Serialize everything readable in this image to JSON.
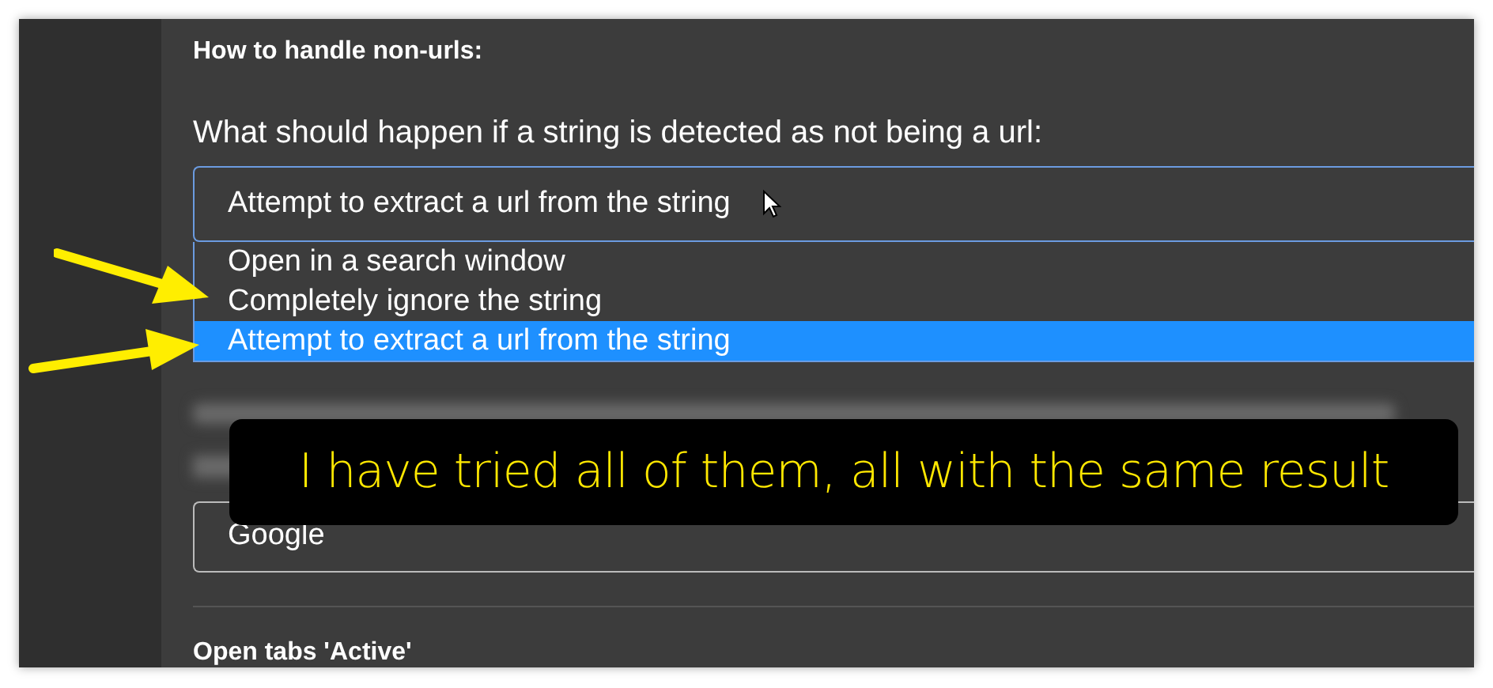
{
  "section_title": "How to handle non-urls:",
  "question": "What should happen if a string is detected as not being a url:",
  "dropdown": {
    "value": "Attempt to extract a url from the string",
    "expanded": true,
    "options": [
      {
        "label": "Open in a search window",
        "selected": false
      },
      {
        "label": "Completely ignore the string",
        "selected": false
      },
      {
        "label": "Attempt to extract a url from the string",
        "selected": true
      }
    ]
  },
  "search_engine_field": {
    "value": "Google"
  },
  "next_section_title": "Open tabs 'Active'",
  "caption": "I have tried all of them, all with the same result"
}
